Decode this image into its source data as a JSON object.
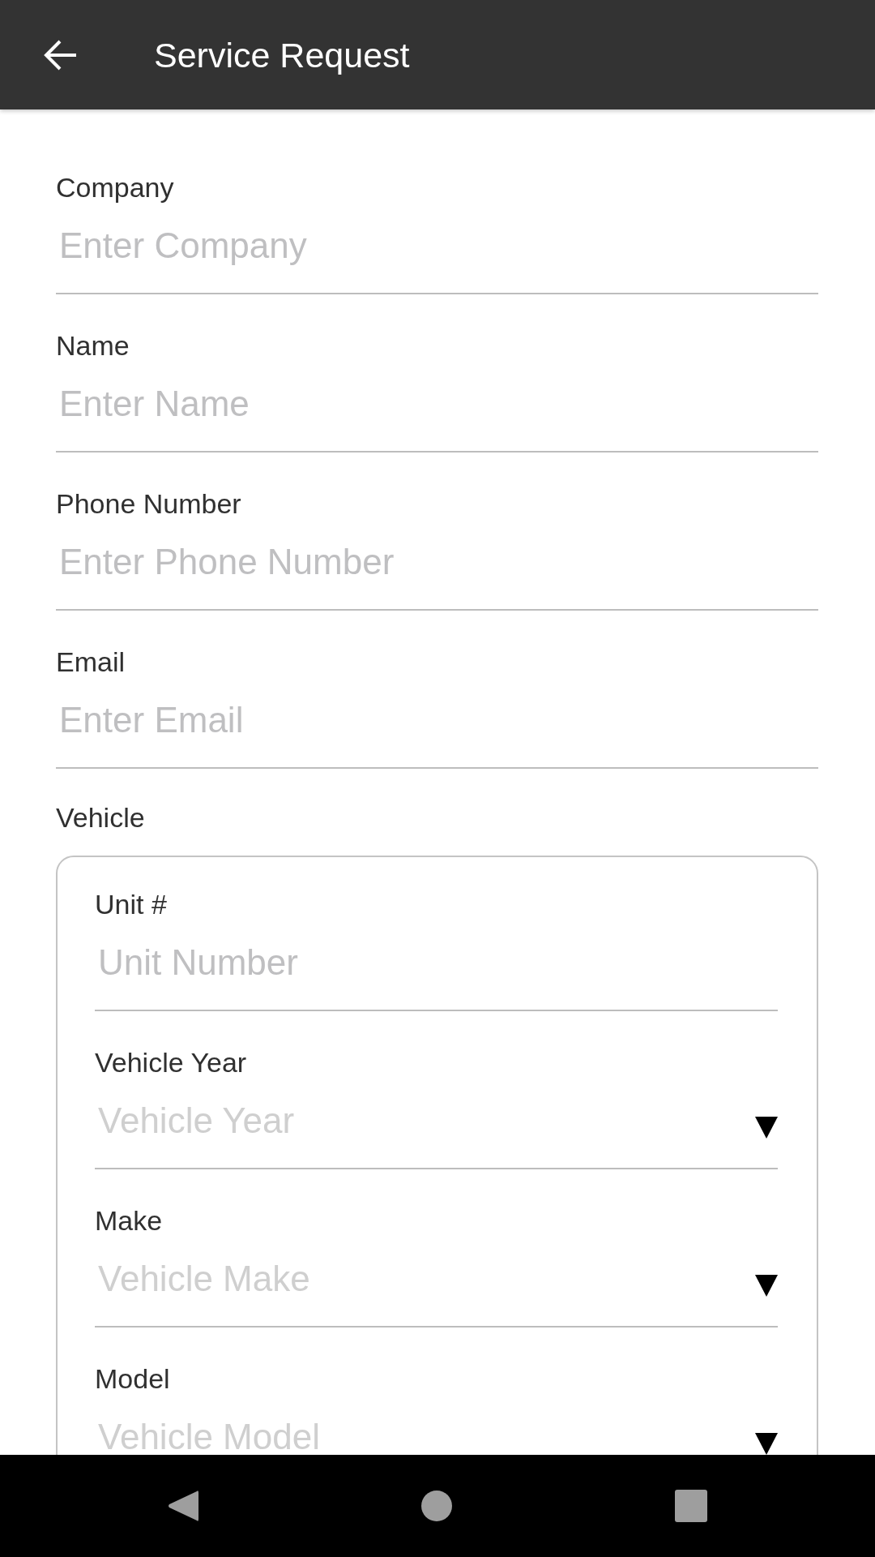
{
  "app_bar": {
    "title": "Service Request"
  },
  "fields": [
    {
      "label": "Company",
      "placeholder": "Enter Company"
    },
    {
      "label": "Name",
      "placeholder": "Enter Name"
    },
    {
      "label": "Phone Number",
      "placeholder": "Enter Phone Number"
    },
    {
      "label": "Email",
      "placeholder": "Enter Email"
    }
  ],
  "vehicle": {
    "label": "Vehicle",
    "fields": [
      {
        "kind": "text",
        "label": "Unit #",
        "placeholder": "Unit Number"
      },
      {
        "kind": "dropdown",
        "label": "Vehicle Year",
        "placeholder": "Vehicle Year"
      },
      {
        "kind": "dropdown",
        "label": "Make",
        "placeholder": "Vehicle Make"
      },
      {
        "kind": "dropdown",
        "label": "Model",
        "placeholder": "Vehicle Model"
      }
    ]
  }
}
